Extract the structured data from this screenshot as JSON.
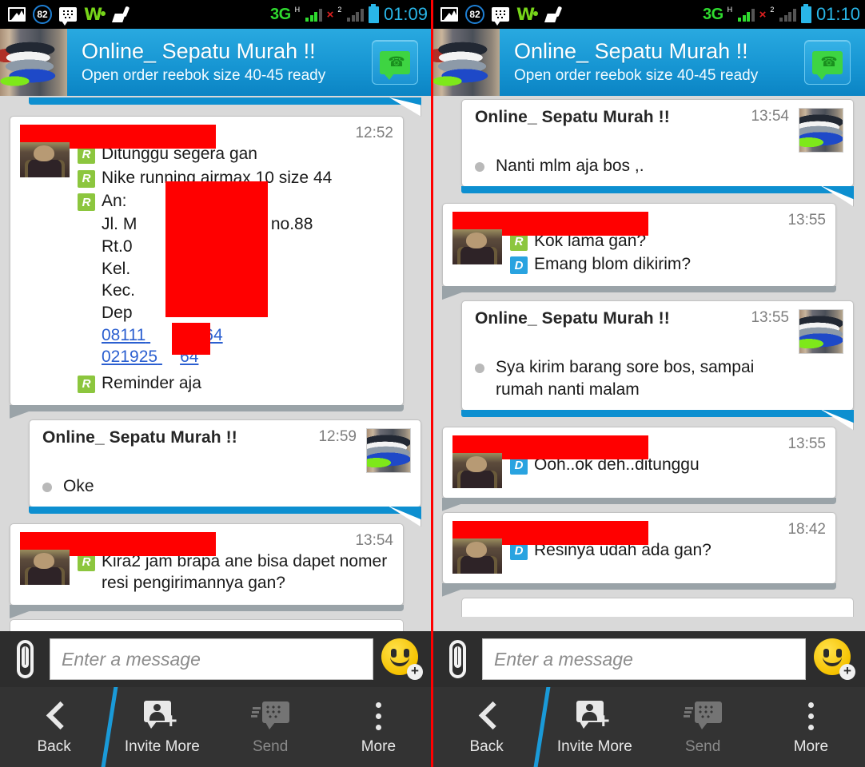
{
  "panels": [
    {
      "id": "left",
      "statusbar": {
        "icons": [
          "photo-icon",
          "notification-count-badge",
          "bbm-icon",
          "walkman-icon",
          "broom-cleaner-icon"
        ],
        "badge_count": "82",
        "network": "3G",
        "network_sup": "H",
        "sim1_sup": "1",
        "sim2_label": "2",
        "sim2_x": "×",
        "clock": "01:09"
      },
      "header": {
        "title": "Online_ Sepatu  Murah !!",
        "subtitle": "Open order reebok size 40-45 ready",
        "avatar": "shoes-photo",
        "action_icon": "voice-chat-icon"
      },
      "messages": [
        {
          "type": "cutoff-top",
          "direction": "incoming"
        },
        {
          "type": "bubble",
          "direction": "outgoing",
          "sender_redacted": true,
          "avatar": "person-photo",
          "time": "12:52",
          "lines": [
            {
              "badge": "R",
              "text": "Ditunggu segera gan"
            },
            {
              "badge": "R",
              "text": "Nike running airmax 10 size 44"
            },
            {
              "badge": "R",
              "text": "An: "
            }
          ],
          "address": {
            "line1": "Jl. M",
            "line1b": "a no.88",
            "line2": "Rt.0",
            "line3": "Kel.",
            "line4": "Kec.",
            "line5": "Dep",
            "phone1_a": "08111",
            "phone1_b": "64",
            "phone2": "021925",
            "phone2_b": "64"
          },
          "tail_line": {
            "badge": "R",
            "text": "Reminder aja"
          }
        },
        {
          "type": "bubble",
          "direction": "incoming",
          "name": "Online_ Sepatu  Murah !!",
          "time": "12:59",
          "thumb": "shoes-photo",
          "lines": [
            {
              "text": "Oke"
            }
          ]
        },
        {
          "type": "bubble",
          "direction": "outgoing",
          "sender_redacted": true,
          "avatar": "person-photo",
          "time": "13:54",
          "lines": [
            {
              "badge": "R",
              "text": "Kira2 jam brapa ane bisa dapet nomer resi pengirimannya gan?"
            }
          ]
        },
        {
          "type": "cutoff-bottom",
          "direction": "outgoing"
        }
      ],
      "compose": {
        "attach_icon": "paperclip-icon",
        "placeholder": "Enter a message",
        "value": "",
        "emoji_icon": "smiley-plus-icon"
      },
      "nav": [
        {
          "label": "Back",
          "icon": "chevron-left-icon",
          "disabled": false
        },
        {
          "label": "Invite More",
          "icon": "invite-person-icon",
          "disabled": false
        },
        {
          "label": "Send",
          "icon": "bbm-send-icon",
          "disabled": true
        },
        {
          "label": "More",
          "icon": "overflow-dots-icon",
          "disabled": false
        }
      ]
    },
    {
      "id": "right",
      "statusbar": {
        "icons": [
          "photo-icon",
          "notification-count-badge",
          "bbm-icon",
          "walkman-icon",
          "broom-cleaner-icon"
        ],
        "badge_count": "82",
        "network": "3G",
        "network_sup": "H",
        "sim1_sup": "1",
        "sim2_label": "2",
        "sim2_x": "×",
        "clock": "01:10"
      },
      "header": {
        "title": "Online_ Sepatu  Murah !!",
        "subtitle": "Open order reebok size 40-45 ready",
        "avatar": "shoes-photo",
        "action_icon": "voice-chat-icon"
      },
      "messages": [
        {
          "type": "bubble",
          "direction": "incoming",
          "name": "Online_ Sepatu  Murah !!",
          "time": "13:54",
          "thumb": "shoes-photo",
          "lines": [
            {
              "text": "Nanti mlm aja bos ,."
            }
          ]
        },
        {
          "type": "bubble",
          "direction": "outgoing",
          "sender_redacted": true,
          "avatar": "person-photo",
          "time": "13:55",
          "lines": [
            {
              "badge": "R",
              "text": "Kok lama gan?"
            },
            {
              "badge": "D",
              "text": "Emang blom dikirim?"
            }
          ]
        },
        {
          "type": "bubble",
          "direction": "incoming",
          "name": "Online_ Sepatu  Murah !!",
          "time": "13:55",
          "thumb": "shoes-photo",
          "lines": [
            {
              "text": "Sya kirim barang sore bos, sampai rumah nanti malam"
            }
          ]
        },
        {
          "type": "bubble",
          "direction": "outgoing",
          "sender_redacted": true,
          "avatar": "person-photo",
          "time": "13:55",
          "lines": [
            {
              "badge": "D",
              "text": "Ooh..ok deh..ditunggu"
            }
          ]
        },
        {
          "type": "bubble",
          "direction": "outgoing",
          "sender_redacted": true,
          "avatar": "person-photo",
          "time": "18:42",
          "lines": [
            {
              "badge": "D",
              "text": "Resinya udah ada gan?"
            }
          ]
        },
        {
          "type": "cutoff-bottom",
          "direction": "outgoing"
        }
      ],
      "compose": {
        "attach_icon": "paperclip-icon",
        "placeholder": "Enter a message",
        "value": "",
        "emoji_icon": "smiley-plus-icon"
      },
      "nav": [
        {
          "label": "Back",
          "icon": "chevron-left-icon",
          "disabled": false
        },
        {
          "label": "Invite More",
          "icon": "invite-person-icon",
          "disabled": false
        },
        {
          "label": "Send",
          "icon": "bbm-send-icon",
          "disabled": true
        },
        {
          "label": "More",
          "icon": "overflow-dots-icon",
          "disabled": false
        }
      ]
    }
  ],
  "colors": {
    "header_blue": "#1796d3",
    "incoming_bar": "#0d8fd0",
    "outgoing_bar": "#9aa3a8",
    "read_badge": "#8cc63e",
    "delivered_badge": "#29a3e0",
    "redaction": "#ff0000",
    "divider": "#ff0000",
    "chat_bg": "#d9d9d9",
    "navbar": "#333333",
    "compose_bg": "#2d2d2d"
  }
}
